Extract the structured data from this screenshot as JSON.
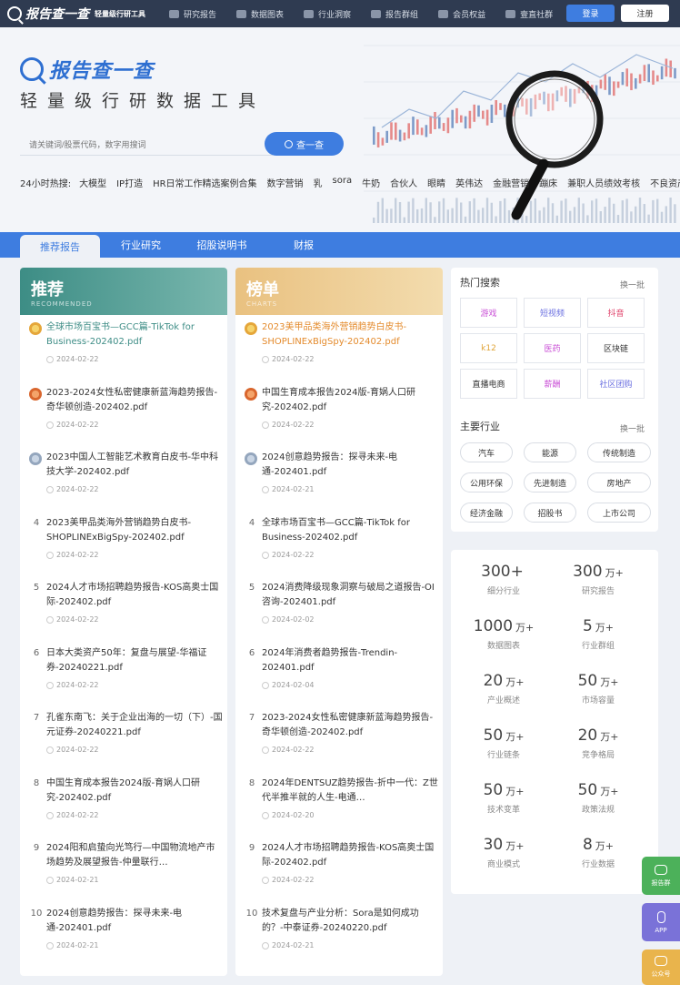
{
  "nav": {
    "logo": "报告查一查",
    "logo_sub": "轻量级行研工具",
    "links": [
      "研究报告",
      "数据图表",
      "行业洞察",
      "报告群组",
      "会员权益",
      "壹直社群"
    ],
    "login": "登录",
    "register": "注册"
  },
  "hero": {
    "brand": "报告查一查",
    "tagline": "轻量级行研数据工具",
    "search_placeholder": "请关键词/股票代码，数字用搜词",
    "search_button": "查一查",
    "hot_label": "24小时热搜:",
    "hot": [
      "大模型",
      "IP打造",
      "HR日常工作精选案例合集",
      "数字营销",
      "乳",
      "sora",
      "牛奶",
      "合伙人",
      "眼睛",
      "英伟达",
      "金融营销",
      "蹦床",
      "兼职人员绩效考核",
      "不良资产处置"
    ]
  },
  "tabs": [
    "推荐报告",
    "行业研究",
    "招股说明书",
    "财报"
  ],
  "recommend": {
    "title": "推荐",
    "subtitle": "RECOMMENDED",
    "items": [
      {
        "rank": "1",
        "title": "全球市场百宝书—GCC篇-TikTok for Business-202402.pdf",
        "date": "2024-02-22"
      },
      {
        "rank": "2",
        "title": "2023-2024女性私密健康新蓝海趋势报告-奇华顿创造-202402.pdf",
        "date": "2024-02-22"
      },
      {
        "rank": "3",
        "title": "2023中国人工智能艺术教育白皮书-华中科技大学-202402.pdf",
        "date": "2024-02-22"
      },
      {
        "rank": "4",
        "title": "2023美甲品类海外营销趋势白皮书-SHOPLINExBigSpy-202402.pdf",
        "date": "2024-02-22"
      },
      {
        "rank": "5",
        "title": "2024人才市场招聘趋势报告-KOS高奥士国际-202402.pdf",
        "date": "2024-02-22"
      },
      {
        "rank": "6",
        "title": "日本大类资产50年：复盘与展望-华福证券-20240221.pdf",
        "date": "2024-02-22"
      },
      {
        "rank": "7",
        "title": "孔雀东南飞：关于企业出海的一切（下）-国元证券-20240221.pdf",
        "date": "2024-02-22"
      },
      {
        "rank": "8",
        "title": "中国生育成本报告2024版-育娲人口研究-202402.pdf",
        "date": "2024-02-22"
      },
      {
        "rank": "9",
        "title": "2024阳和启蛰向光笃行—中国物流地产市场趋势及展望报告-仲量联行…",
        "date": "2024-02-21"
      },
      {
        "rank": "10",
        "title": "2024创意趋势报告：探寻未来-电通-202401.pdf",
        "date": "2024-02-21"
      }
    ]
  },
  "ranking": {
    "title": "榜单",
    "subtitle": "CHARTS",
    "items": [
      {
        "rank": "1",
        "title": "2023美甲品类海外营销趋势白皮书-SHOPLINExBigSpy-202402.pdf",
        "date": "2024-02-22"
      },
      {
        "rank": "2",
        "title": "中国生育成本报告2024版-育娲人口研究-202402.pdf",
        "date": "2024-02-22"
      },
      {
        "rank": "3",
        "title": "2024创意趋势报告：探寻未来-电通-202401.pdf",
        "date": "2024-02-21"
      },
      {
        "rank": "4",
        "title": "全球市场百宝书—GCC篇-TikTok for Business-202402.pdf",
        "date": "2024-02-22"
      },
      {
        "rank": "5",
        "title": "2024消费降级现象洞察与破局之道报告-OI咨询-202401.pdf",
        "date": "2024-02-02"
      },
      {
        "rank": "6",
        "title": "2024年消费者趋势报告-Trendin-202401.pdf",
        "date": "2024-02-04"
      },
      {
        "rank": "7",
        "title": "2023-2024女性私密健康新蓝海趋势报告-奇华顿创造-202402.pdf",
        "date": "2024-02-22"
      },
      {
        "rank": "8",
        "title": "2024年DENTSUZ趋势报告-折中一代：Z世代半推半就的人生-电通…",
        "date": "2024-02-20"
      },
      {
        "rank": "9",
        "title": "2024人才市场招聘趋势报告-KOS高奥士国际-202402.pdf",
        "date": "2024-02-22"
      },
      {
        "rank": "10",
        "title": "技术复盘与产业分析：Sora是如何成功的？-中泰证券-20240220.pdf",
        "date": "2024-02-21"
      }
    ]
  },
  "hot_search": {
    "title": "热门搜索",
    "more": "换一批",
    "items": [
      {
        "label": "游戏",
        "color": "#c94fd6"
      },
      {
        "label": "短视频",
        "color": "#6a6fe0"
      },
      {
        "label": "抖音",
        "color": "#e0436b"
      },
      {
        "label": "k12",
        "color": "#e0a53a"
      },
      {
        "label": "医药",
        "color": "#c94fd6"
      },
      {
        "label": "区块链",
        "color": "#333333"
      },
      {
        "label": "直播电商",
        "color": "#333333"
      },
      {
        "label": "薪酬",
        "color": "#c94fd6"
      },
      {
        "label": "社区团购",
        "color": "#6a6fe0"
      }
    ]
  },
  "industries": {
    "title": "主要行业",
    "more": "换一批",
    "items": [
      "汽车",
      "能源",
      "传统制造",
      "公用环保",
      "先进制造",
      "房地产",
      "经济金融",
      "招股书",
      "上市公司"
    ]
  },
  "stats": [
    {
      "value": "300+",
      "unit": "",
      "label": "细分行业"
    },
    {
      "value": "300",
      "unit": "万+",
      "label": "研究报告"
    },
    {
      "value": "1000",
      "unit": "万+",
      "label": "数据图表"
    },
    {
      "value": "5",
      "unit": "万+",
      "label": "行业群组"
    },
    {
      "value": "20",
      "unit": "万+",
      "label": "产业概述"
    },
    {
      "value": "50",
      "unit": "万+",
      "label": "市场容量"
    },
    {
      "value": "50",
      "unit": "万+",
      "label": "行业链条"
    },
    {
      "value": "20",
      "unit": "万+",
      "label": "竞争格局"
    },
    {
      "value": "50",
      "unit": "万+",
      "label": "技术变革"
    },
    {
      "value": "50",
      "unit": "万+",
      "label": "政策法规"
    },
    {
      "value": "30",
      "unit": "万+",
      "label": "商业模式"
    },
    {
      "value": "8",
      "unit": "万+",
      "label": "行业数据"
    }
  ],
  "float": {
    "group": "报告群",
    "app": "APP",
    "official": "公众号"
  }
}
